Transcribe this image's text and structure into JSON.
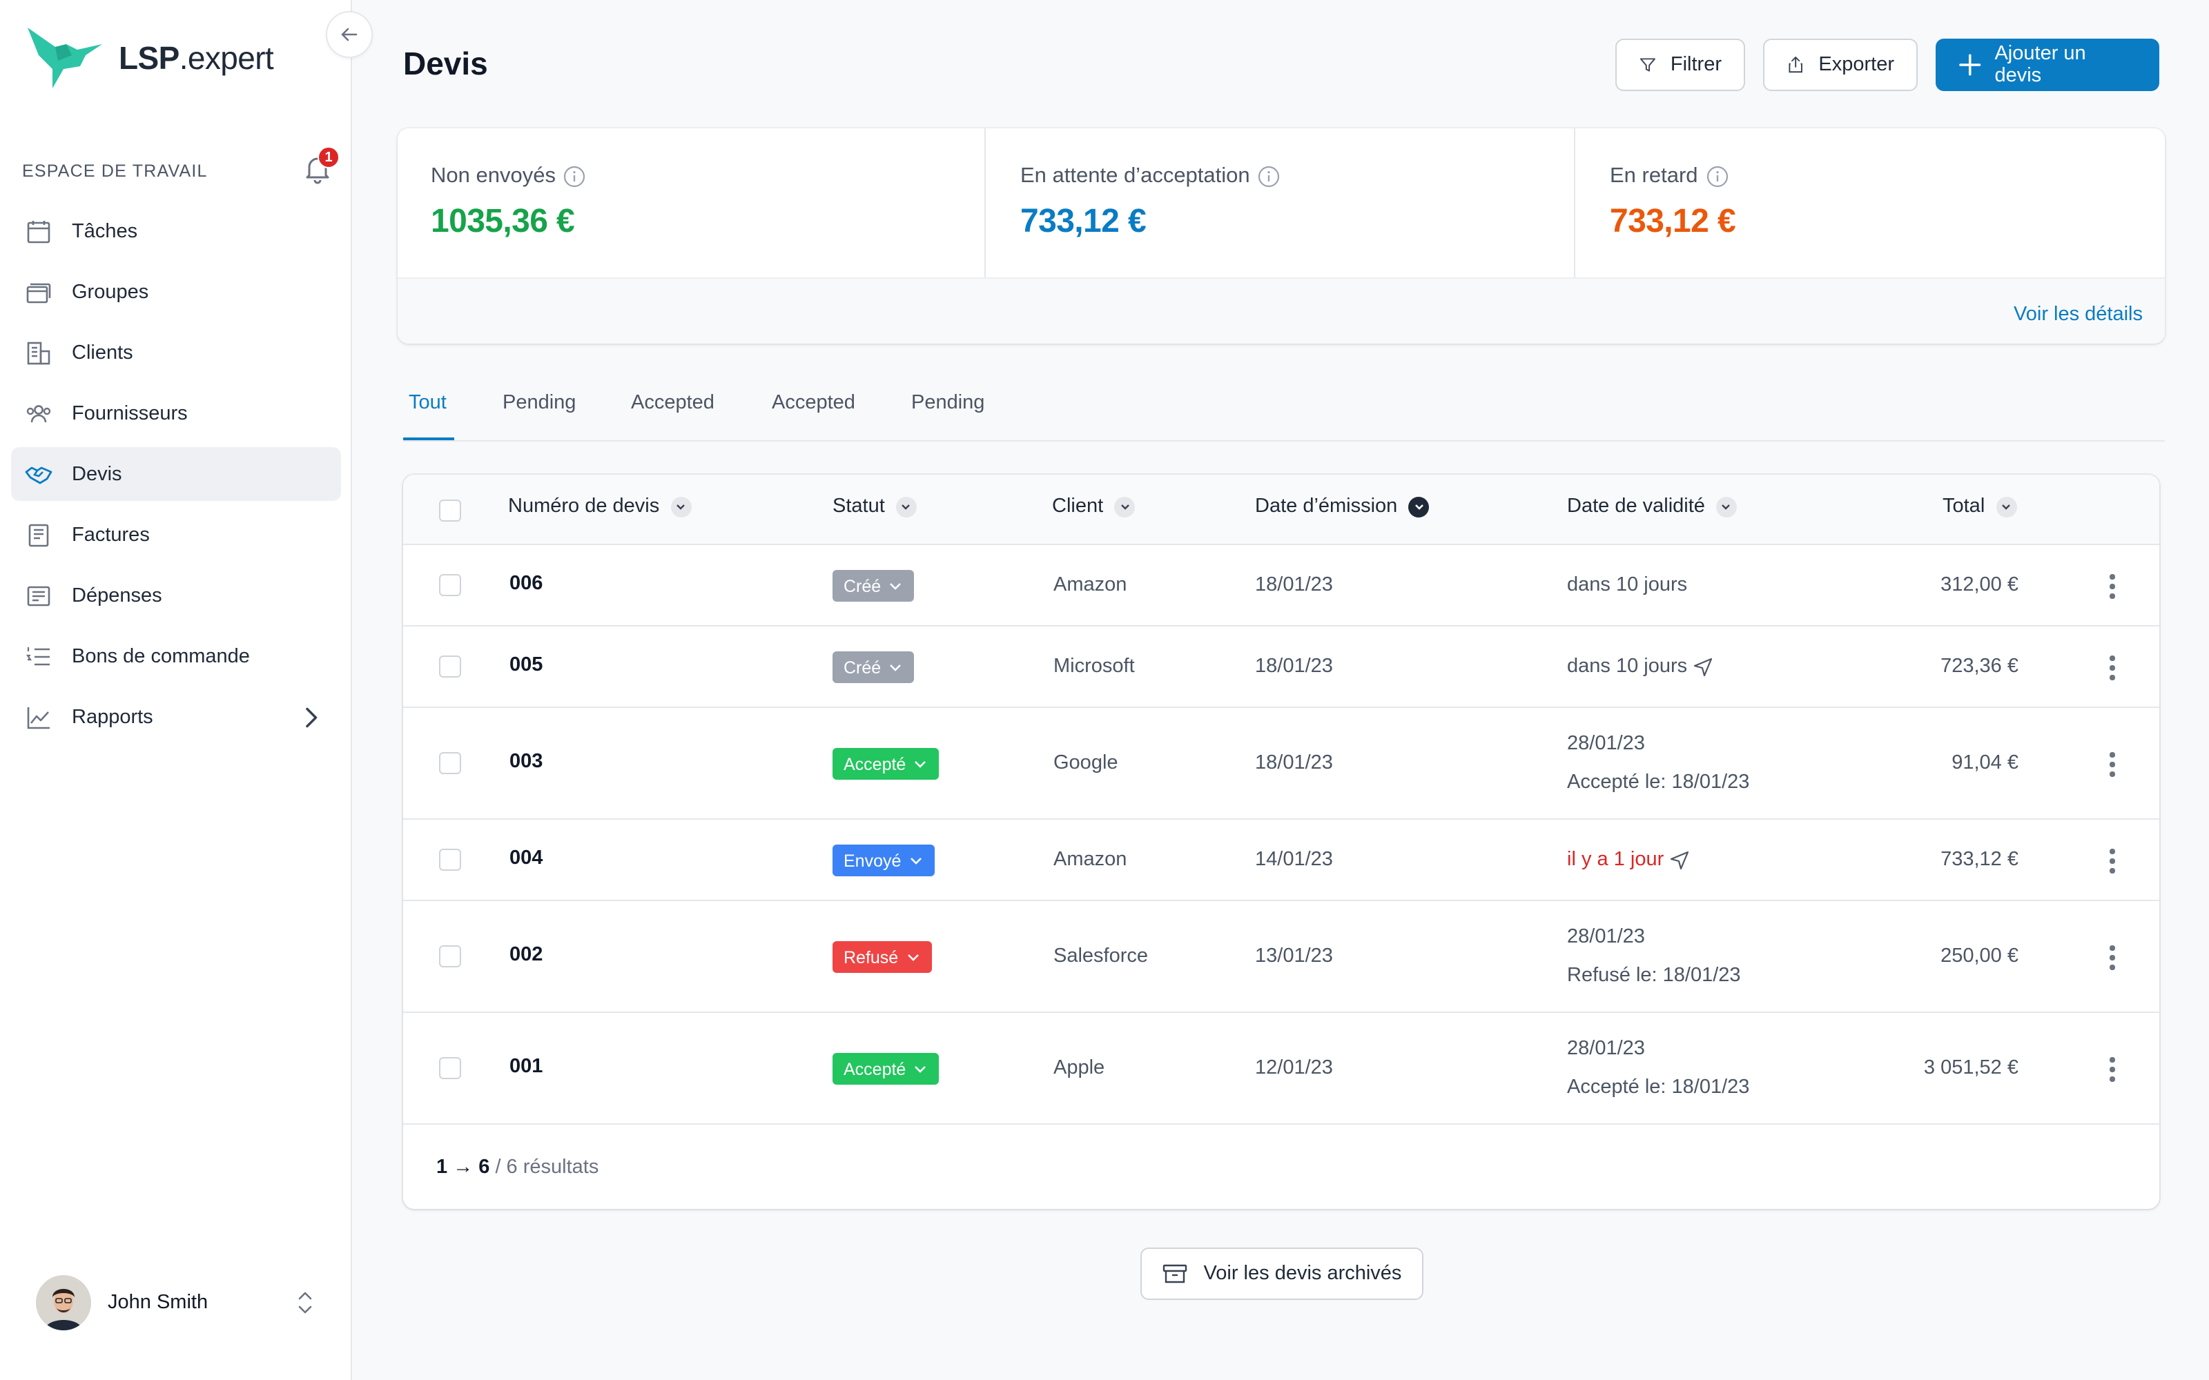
{
  "app": {
    "logo_bold": "LSP",
    "logo_rest": ".expert"
  },
  "sidebar": {
    "workspace_label": "ESPACE DE TRAVAIL",
    "notification_count": "1",
    "items": [
      {
        "label": "Tâches",
        "icon": "calendar-icon"
      },
      {
        "label": "Groupes",
        "icon": "stack-icon"
      },
      {
        "label": "Clients",
        "icon": "building-icon"
      },
      {
        "label": "Fournisseurs",
        "icon": "users-icon"
      },
      {
        "label": "Devis",
        "icon": "handshake-icon",
        "active": true
      },
      {
        "label": "Factures",
        "icon": "invoice-icon"
      },
      {
        "label": "Dépenses",
        "icon": "receipt-icon"
      },
      {
        "label": "Bons de commande",
        "icon": "list-numbered-icon"
      },
      {
        "label": "Rapports",
        "icon": "chart-line-icon"
      }
    ],
    "user": {
      "name": "John Smith"
    }
  },
  "header": {
    "title": "Devis",
    "filter_label": "Filtrer",
    "export_label": "Exporter",
    "add_label": "Ajouter un devis"
  },
  "stats": {
    "items": [
      {
        "label": "Non envoyés",
        "value": "1035,36 €",
        "color": "#16a34a"
      },
      {
        "label": "En attente d’acceptation",
        "value": "733,12 €",
        "color": "#0a7cc4"
      },
      {
        "label": "En retard",
        "value": "733,12 €",
        "color": "#ea580c"
      }
    ],
    "details_link": "Voir les détails"
  },
  "tabs": [
    "Tout",
    "Pending",
    "Accepted",
    "Accepted",
    "Pending"
  ],
  "table": {
    "columns": [
      "Numéro de devis",
      "Statut",
      "Client",
      "Date d’émission",
      "Date de validité",
      "Total"
    ],
    "rows": [
      {
        "number": "006",
        "status": "Créé",
        "status_color": "#9ca3af",
        "client": "Amazon",
        "issued": "18/01/23",
        "validity": "dans 10 jours",
        "validity_note": "",
        "total": "312,00 €"
      },
      {
        "number": "005",
        "status": "Créé",
        "status_color": "#9ca3af",
        "client": "Microsoft",
        "issued": "18/01/23",
        "validity": "dans 10 jours",
        "validity_note": "",
        "total": "723,36 €"
      },
      {
        "number": "003",
        "status": "Accepté",
        "status_color": "#22c55e",
        "client": "Google",
        "issued": "18/01/23",
        "validity": "28/01/23",
        "validity_note": "Accepté le: 18/01/23",
        "total": "91,04 €"
      },
      {
        "number": "004",
        "status": "Envoyé",
        "status_color": "#3b82f6",
        "client": "Amazon",
        "issued": "14/01/23",
        "validity": "il y a 1 jour",
        "validity_note": "",
        "total": "733,12 €"
      },
      {
        "number": "002",
        "status": "Refusé",
        "status_color": "#ef4444",
        "client": "Salesforce",
        "issued": "13/01/23",
        "validity": "28/01/23",
        "validity_note": "Refusé le: 18/01/23",
        "total": "250,00 €"
      },
      {
        "number": "001",
        "status": "Accepté",
        "status_color": "#22c55e",
        "client": "Apple",
        "issued": "12/01/23",
        "validity": "28/01/23",
        "validity_note": "Accepté le: 18/01/23",
        "total": "3 051,52 €"
      }
    ],
    "pagination_range": "1 → 6",
    "pagination_total": "/ 6 résultats"
  },
  "archive_button": "Voir les devis archivés",
  "colors": {
    "accent": "#0a7cc4",
    "overdue": "#dc2626"
  }
}
